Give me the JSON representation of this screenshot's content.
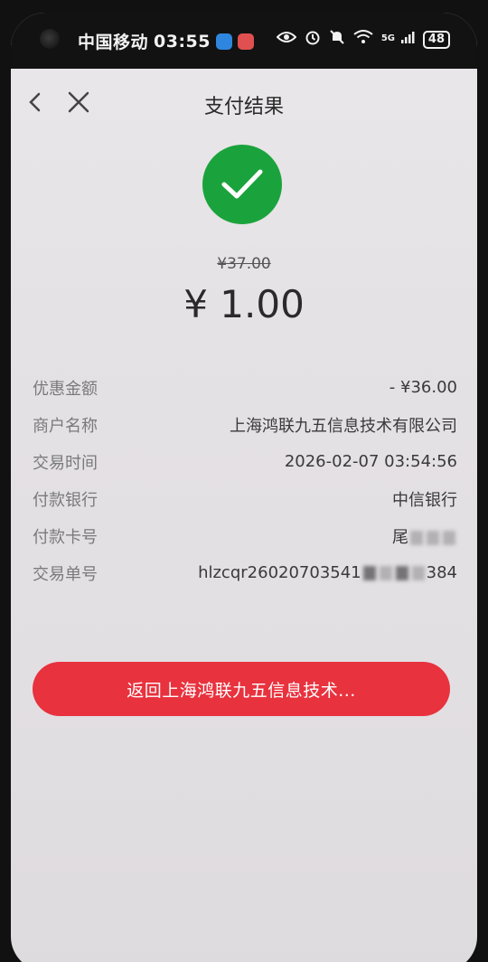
{
  "status_bar": {
    "carrier": "中国移动",
    "time": "03:55",
    "network": "5G",
    "battery": "48"
  },
  "header": {
    "title": "支付结果"
  },
  "payment": {
    "original_price": "¥37.00",
    "paid_amount": "¥ 1.00"
  },
  "details": [
    {
      "label": "优惠金额",
      "value": "- ¥36.00"
    },
    {
      "label": "商户名称",
      "value": "上海鸿联九五信息技术有限公司"
    },
    {
      "label": "交易时间",
      "value": "2026-02-07 03:54:56"
    },
    {
      "label": "付款银行",
      "value": "中信银行"
    },
    {
      "label": "付款卡号",
      "value_prefix": "尾",
      "value_suffix": ""
    },
    {
      "label": "交易单号",
      "value_prefix": "hlzcqr26020703541",
      "value_suffix": "384"
    }
  ],
  "return_button": {
    "label": "返回上海鸿联九五信息技术..."
  },
  "colors": {
    "success_green": "#1aa33c",
    "button_red": "#e8323e"
  }
}
